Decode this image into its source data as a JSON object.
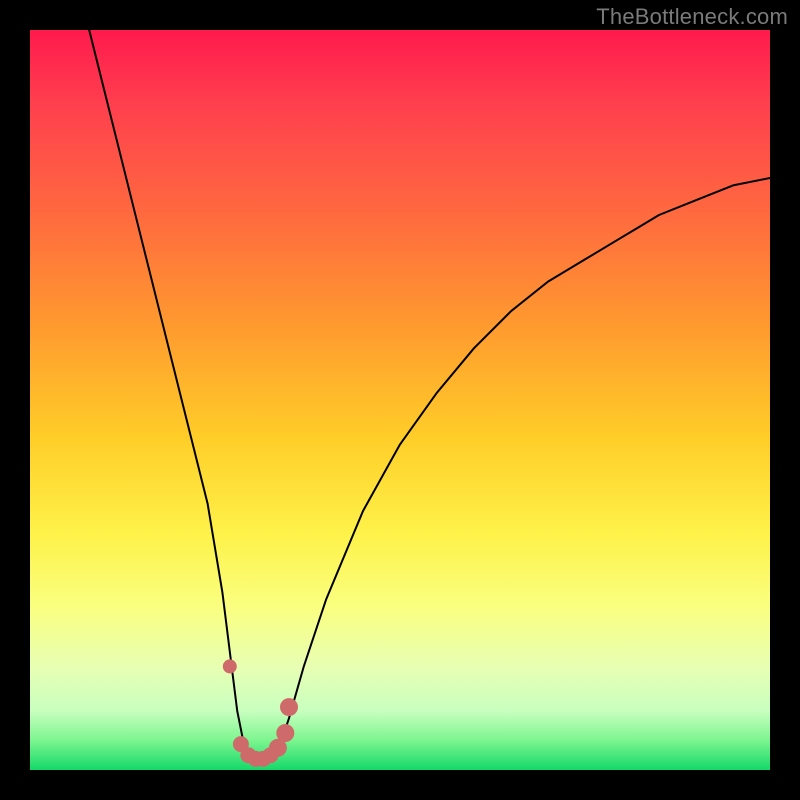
{
  "watermark": "TheBottleneck.com",
  "chart_data": {
    "type": "line",
    "title": "",
    "xlabel": "",
    "ylabel": "",
    "xlim": [
      0,
      100
    ],
    "ylim": [
      0,
      100
    ],
    "series": [
      {
        "name": "bottleneck-curve",
        "x": [
          8,
          10,
          12,
          14,
          16,
          18,
          20,
          22,
          24,
          26,
          27,
          28,
          29,
          30,
          31,
          32,
          33,
          34,
          35,
          37,
          40,
          45,
          50,
          55,
          60,
          65,
          70,
          75,
          80,
          85,
          90,
          95,
          100
        ],
        "y": [
          100,
          92,
          84,
          76,
          68,
          60,
          52,
          44,
          36,
          24,
          16,
          8,
          3,
          1,
          1,
          1,
          2,
          4,
          7,
          14,
          23,
          35,
          44,
          51,
          57,
          62,
          66,
          69,
          72,
          75,
          77,
          79,
          80
        ]
      }
    ],
    "markers": {
      "name": "highlighted-points",
      "color": "#cf6a6a",
      "points": [
        {
          "x": 27.0,
          "y": 14.0,
          "r": 7
        },
        {
          "x": 28.5,
          "y": 3.5,
          "r": 8
        },
        {
          "x": 29.5,
          "y": 2.0,
          "r": 8
        },
        {
          "x": 30.5,
          "y": 1.5,
          "r": 8
        },
        {
          "x": 31.5,
          "y": 1.5,
          "r": 8
        },
        {
          "x": 32.5,
          "y": 2.0,
          "r": 8
        },
        {
          "x": 33.5,
          "y": 3.0,
          "r": 9
        },
        {
          "x": 34.5,
          "y": 5.0,
          "r": 9
        },
        {
          "x": 35.0,
          "y": 8.5,
          "r": 9
        }
      ]
    }
  }
}
